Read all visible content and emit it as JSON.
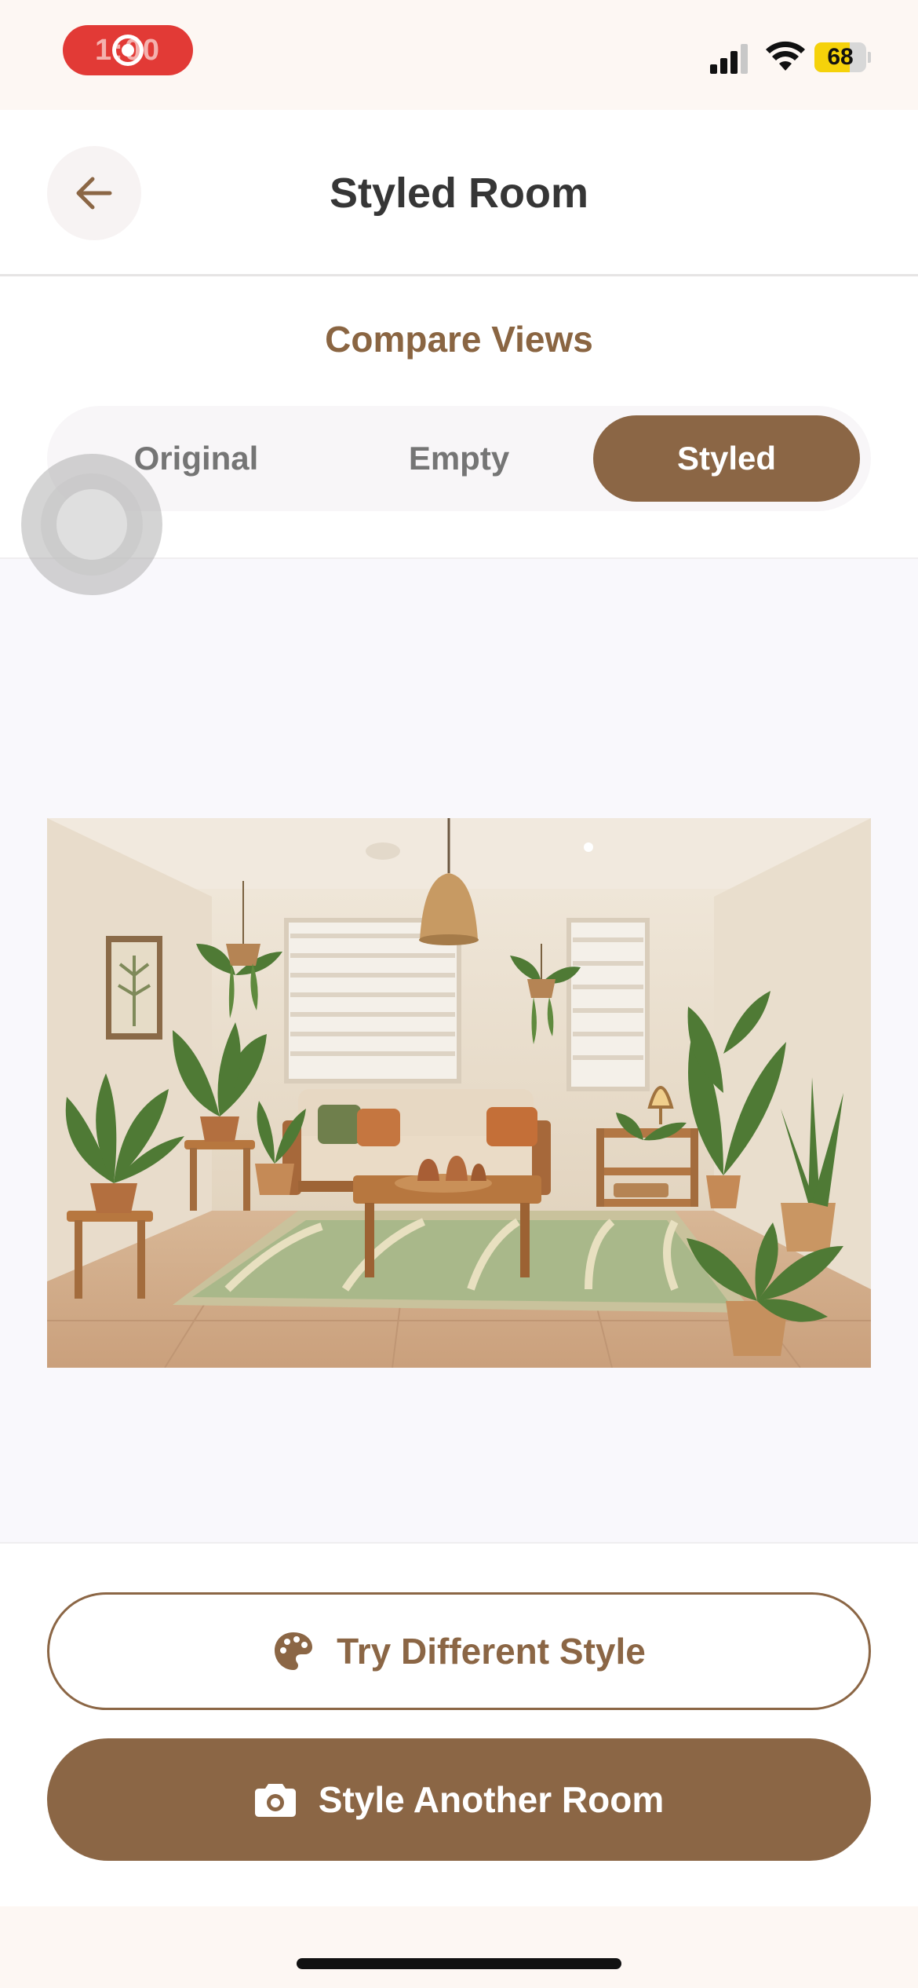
{
  "status_bar": {
    "recording_time": "1:00",
    "battery_level": "68",
    "battery_fraction": 0.68
  },
  "header": {
    "title": "Styled Room",
    "back_icon": "arrow-left-icon"
  },
  "compare": {
    "heading": "Compare Views",
    "segments": [
      {
        "label": "Original",
        "active": false
      },
      {
        "label": "Empty",
        "active": false
      },
      {
        "label": "Styled",
        "active": true
      }
    ]
  },
  "image": {
    "description_icon": "styled-room-photo"
  },
  "actions": {
    "try_style_label": "Try Different Style",
    "try_style_icon": "palette-icon",
    "another_room_label": "Style Another Room",
    "another_room_icon": "camera-icon"
  },
  "colors": {
    "accent": "#8b6645",
    "heading": "#8a6542",
    "record": "#e23a36",
    "battery": "#f5d20a"
  }
}
